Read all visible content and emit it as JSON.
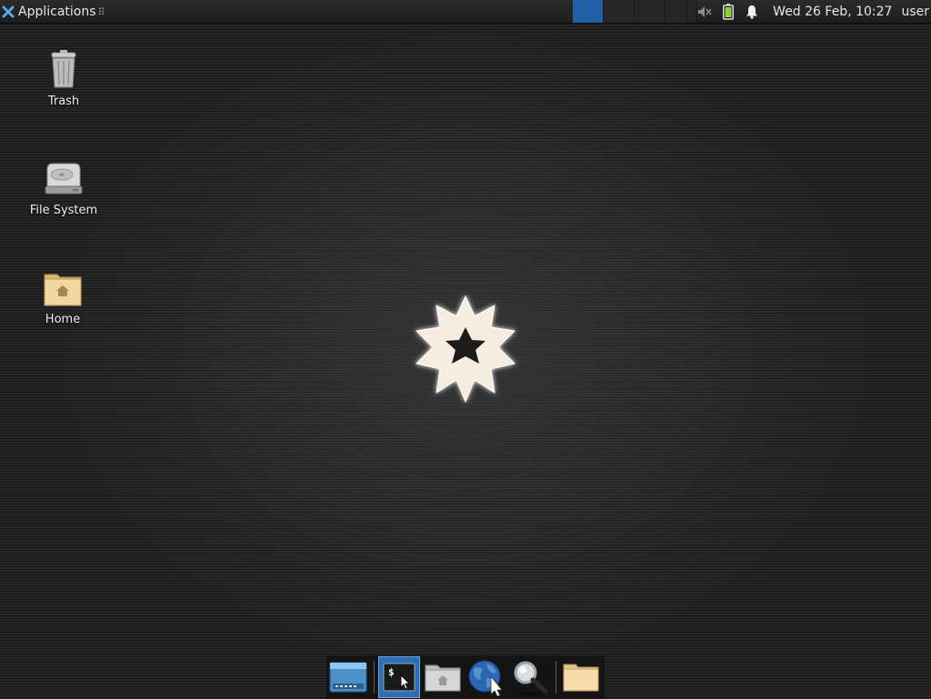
{
  "top_panel": {
    "applications_label": "Applications",
    "grip": "⠿",
    "workspaces": [
      {
        "name": "Workspace 1",
        "active": true
      },
      {
        "name": "Workspace 2",
        "active": false
      },
      {
        "name": "Workspace 3",
        "active": false
      },
      {
        "name": "Workspace 4",
        "active": false
      }
    ],
    "tray_icons": [
      "volume-muted-icon",
      "battery-icon",
      "notification-bell-icon"
    ],
    "clock": "Wed 26 Feb, 10:27",
    "user": "user"
  },
  "desktop": {
    "icons": [
      {
        "label": "Trash",
        "icon": "trash-icon"
      },
      {
        "label": "File System",
        "icon": "drive-icon"
      },
      {
        "label": "Home",
        "icon": "home-folder-icon"
      }
    ],
    "center_logo": "xfce-star-logo"
  },
  "dock": {
    "items": [
      {
        "name": "Show Desktop",
        "icon": "desktop-icon",
        "active": false
      },
      {
        "name": "Terminal",
        "icon": "terminal-icon",
        "active": true
      },
      {
        "name": "File Manager",
        "icon": "home-folder-icon",
        "active": false
      },
      {
        "name": "Web Browser",
        "icon": "globe-icon",
        "active": false
      },
      {
        "name": "App Finder",
        "icon": "magnifier-icon",
        "active": false
      },
      {
        "name": "Folder",
        "icon": "folder-icon",
        "active": false
      }
    ]
  },
  "colors": {
    "accent": "#2d6fb5",
    "workspace_active": "#1f5fa6"
  }
}
